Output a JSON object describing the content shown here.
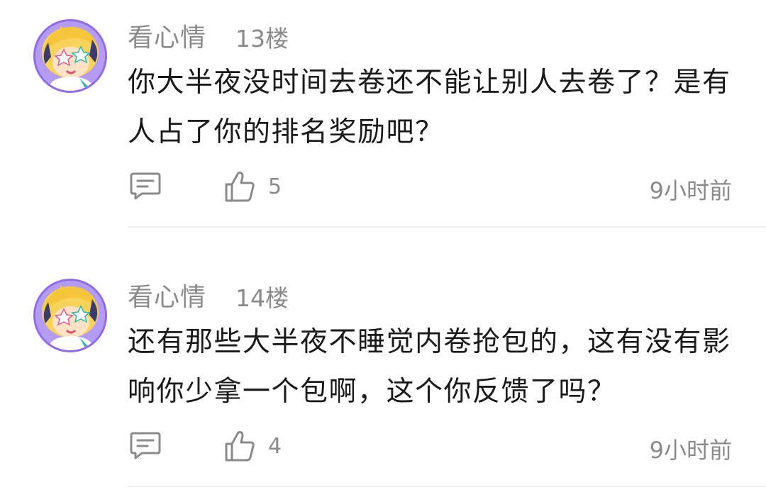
{
  "comments": [
    {
      "username": "看心情",
      "floor": "13楼",
      "text": "你大半夜没时间去卷还不能让别人去卷了？是有人占了你的排名奖励吧？",
      "like_count": "5",
      "time": "9小时前"
    },
    {
      "username": "看心情",
      "floor": "14楼",
      "text": "还有那些大半夜不睡觉内卷抢包的，这有没有影响你少拿一个包啊，这个你反馈了吗？",
      "like_count": "4",
      "time": "9小时前"
    }
  ],
  "icons": {
    "reply": "comment-bubble-icon",
    "like": "thumbs-up-icon"
  },
  "colors": {
    "text_primary": "#1a1a1a",
    "text_secondary": "#8a8a8a",
    "avatar_ring": "#8f6be8",
    "divider": "#efefef"
  }
}
